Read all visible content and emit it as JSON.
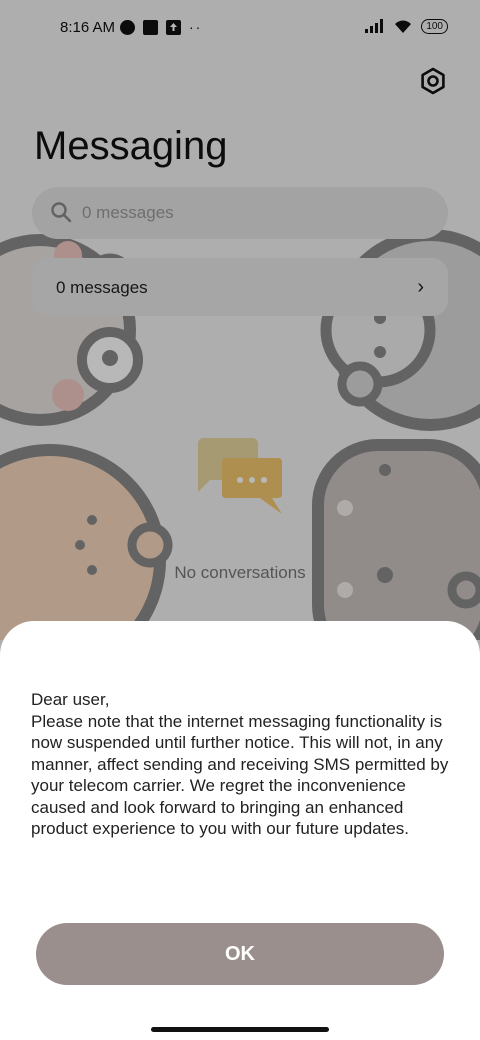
{
  "status_bar": {
    "time": "8:16 AM",
    "battery": "100",
    "icons": [
      "vpn-icon",
      "notification-square-icon",
      "upload-icon",
      "more-dots-icon",
      "signal-icon",
      "wifi-icon",
      "battery-icon"
    ]
  },
  "app": {
    "title": "Messaging",
    "search_placeholder": "0 messages",
    "row_label": "0 messages",
    "empty_text": "No conversations"
  },
  "dialog": {
    "greeting": "Dear user,",
    "body": "Please note that the internet messaging functionality is now suspended until further notice. This will not, in any manner, affect sending and receiving SMS permitted by your telecom carrier. We regret the inconvenience caused and look forward to bringing an enhanced product experience to you with our future updates.",
    "ok_label": "OK"
  },
  "colors": {
    "ok_button": "#9b8f8e",
    "overlay": "rgba(0,0,0,0.28)"
  }
}
